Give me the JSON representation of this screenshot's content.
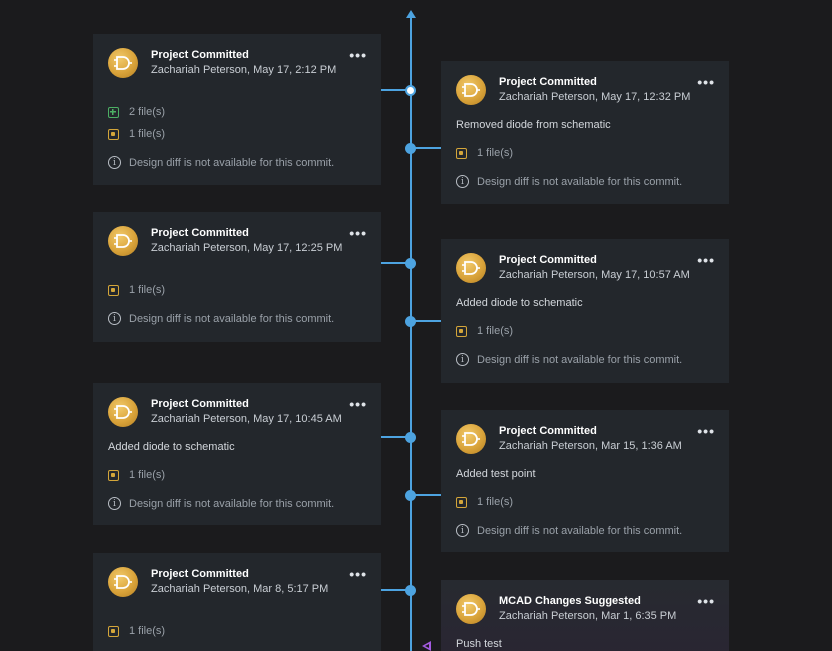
{
  "timeline": {
    "left_commits": [
      {
        "title": "Project Committed",
        "subtitle": "Zachariah Peterson, May 17, 2:12 PM",
        "message": "",
        "files": [
          {
            "kind": "added",
            "label": "2 file(s)"
          },
          {
            "kind": "modified",
            "label": "1 file(s)"
          }
        ],
        "diff_note": "Design diff is not available for this commit."
      },
      {
        "title": "Project Committed",
        "subtitle": "Zachariah Peterson, May 17, 12:25 PM",
        "message": "",
        "files": [
          {
            "kind": "modified",
            "label": "1 file(s)"
          }
        ],
        "diff_note": "Design diff is not available for this commit."
      },
      {
        "title": "Project Committed",
        "subtitle": "Zachariah Peterson, May 17, 10:45 AM",
        "message": "Added diode to schematic",
        "files": [
          {
            "kind": "modified",
            "label": "1 file(s)"
          }
        ],
        "diff_note": "Design diff is not available for this commit."
      },
      {
        "title": "Project Committed",
        "subtitle": "Zachariah Peterson, Mar 8, 5:17 PM",
        "message": "",
        "files": [
          {
            "kind": "modified",
            "label": "1 file(s)"
          }
        ],
        "diff_note": ""
      }
    ],
    "right_commits": [
      {
        "title": "Project Committed",
        "subtitle": "Zachariah Peterson, May 17, 12:32 PM",
        "message": "Removed diode from schematic",
        "files": [
          {
            "kind": "modified",
            "label": "1 file(s)"
          }
        ],
        "diff_note": "Design diff is not available for this commit."
      },
      {
        "title": "Project Committed",
        "subtitle": "Zachariah Peterson, May 17, 10:57 AM",
        "message": "Added diode to schematic",
        "files": [
          {
            "kind": "modified",
            "label": "1 file(s)"
          }
        ],
        "diff_note": "Design diff is not available for this commit."
      },
      {
        "title": "Project Committed",
        "subtitle": "Zachariah Peterson, Mar 15, 1:36 AM",
        "message": "Added test point",
        "files": [
          {
            "kind": "modified",
            "label": "1 file(s)"
          }
        ],
        "diff_note": "Design diff is not available for this commit."
      },
      {
        "title": "MCAD Changes Suggested",
        "subtitle": "Zachariah Peterson, Mar 1, 6:35 PM",
        "message": "Push test",
        "files": [],
        "diff_note": ""
      }
    ],
    "more_label": "•••",
    "info_glyph": "i",
    "icons": {
      "avatar": "and-gate-icon",
      "file_added": "file-added-icon",
      "file_modified": "file-modified-icon",
      "info": "info-icon",
      "more": "more-options-icon"
    },
    "colors": {
      "background": "#1b1b1d",
      "card": "#23272c",
      "line": "#4da3e0",
      "suggestion": "#a45be0"
    }
  }
}
